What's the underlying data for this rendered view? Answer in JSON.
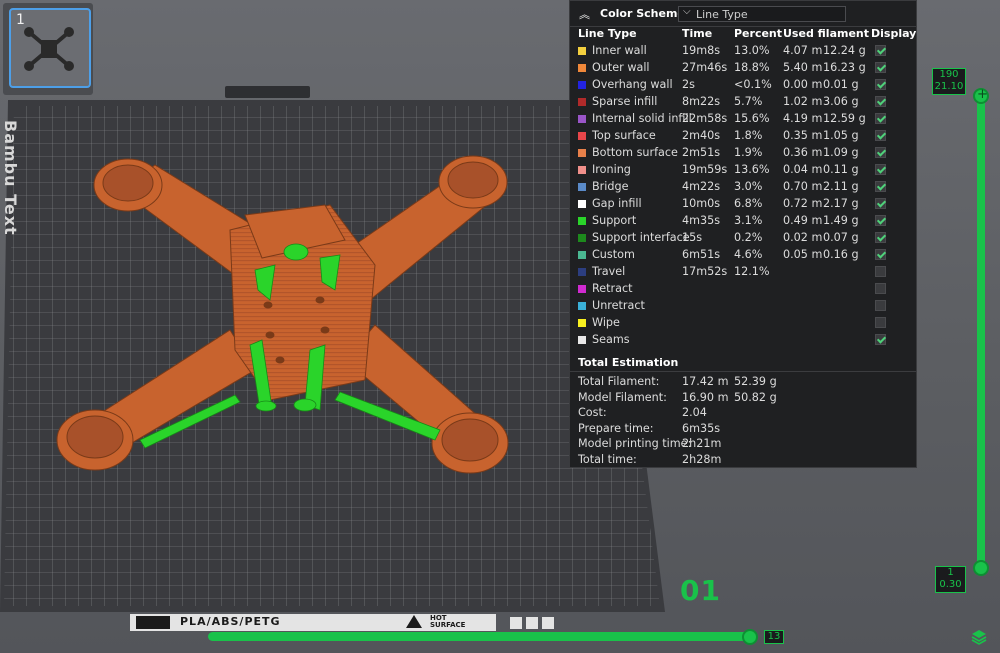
{
  "thumbnail": {
    "plate_index": "1"
  },
  "color_scheme": {
    "title": "Color Scheme",
    "selected": "Line Type"
  },
  "columns": {
    "line_type": "Line Type",
    "time": "Time",
    "percent": "Percent",
    "used_filament": "Used filament",
    "display": "Display"
  },
  "line_types": [
    {
      "name": "Inner wall",
      "color": "#f4d03f",
      "time": "19m8s",
      "percent": "13.0%",
      "length": "4.07 m",
      "weight": "12.24 g",
      "display": true
    },
    {
      "name": "Outer wall",
      "color": "#f0883a",
      "time": "27m46s",
      "percent": "18.8%",
      "length": "5.40 m",
      "weight": "16.23 g",
      "display": true
    },
    {
      "name": "Overhang wall",
      "color": "#2323e0",
      "time": "2s",
      "percent": "<0.1%",
      "length": "0.00 m",
      "weight": "0.01 g",
      "display": true
    },
    {
      "name": "Sparse infill",
      "color": "#b02a2a",
      "time": "8m22s",
      "percent": "5.7%",
      "length": "1.02 m",
      "weight": "3.06 g",
      "display": true
    },
    {
      "name": "Internal solid infill",
      "color": "#9a55c8",
      "time": "22m58s",
      "percent": "15.6%",
      "length": "4.19 m",
      "weight": "12.59 g",
      "display": true
    },
    {
      "name": "Top surface",
      "color": "#e8464a",
      "time": "2m40s",
      "percent": "1.8%",
      "length": "0.35 m",
      "weight": "1.05 g",
      "display": true
    },
    {
      "name": "Bottom surface",
      "color": "#e8804a",
      "time": "2m51s",
      "percent": "1.9%",
      "length": "0.36 m",
      "weight": "1.09 g",
      "display": true
    },
    {
      "name": "Ironing",
      "color": "#f08f8a",
      "time": "19m59s",
      "percent": "13.6%",
      "length": "0.04 m",
      "weight": "0.11 g",
      "display": true
    },
    {
      "name": "Bridge",
      "color": "#5a8ac8",
      "time": "4m22s",
      "percent": "3.0%",
      "length": "0.70 m",
      "weight": "2.11 g",
      "display": true
    },
    {
      "name": "Gap infill",
      "color": "#ffffff",
      "time": "10m0s",
      "percent": "6.8%",
      "length": "0.72 m",
      "weight": "2.17 g",
      "display": true
    },
    {
      "name": "Support",
      "color": "#2ad42a",
      "time": "4m35s",
      "percent": "3.1%",
      "length": "0.49 m",
      "weight": "1.49 g",
      "display": true
    },
    {
      "name": "Support interface",
      "color": "#1d8a1d",
      "time": "15s",
      "percent": "0.2%",
      "length": "0.02 m",
      "weight": "0.07 g",
      "display": true
    },
    {
      "name": "Custom",
      "color": "#4ab892",
      "time": "6m51s",
      "percent": "4.6%",
      "length": "0.05 m",
      "weight": "0.16 g",
      "display": true
    },
    {
      "name": "Travel",
      "color": "#2c3e80",
      "time": "17m52s",
      "percent": "12.1%",
      "length": "",
      "weight": "",
      "display": false
    },
    {
      "name": "Retract",
      "color": "#d02ad0",
      "time": "",
      "percent": "",
      "length": "",
      "weight": "",
      "display": false
    },
    {
      "name": "Unretract",
      "color": "#3ab0d8",
      "time": "",
      "percent": "",
      "length": "",
      "weight": "",
      "display": false
    },
    {
      "name": "Wipe",
      "color": "#f8f020",
      "time": "",
      "percent": "",
      "length": "",
      "weight": "",
      "display": false
    },
    {
      "name": "Seams",
      "color": "#e8e8e8",
      "time": "",
      "percent": "",
      "length": "",
      "weight": "",
      "display": true
    }
  ],
  "total_estimation": {
    "title": "Total Estimation",
    "rows": [
      {
        "key": "Total Filament:",
        "v1": "17.42 m",
        "v2": "52.39 g"
      },
      {
        "key": "Model Filament:",
        "v1": "16.90 m",
        "v2": "50.82 g"
      },
      {
        "key": "Cost:",
        "v1": "2.04",
        "v2": ""
      },
      {
        "key": "Prepare time:",
        "v1": "6m35s",
        "v2": ""
      },
      {
        "key": "Model printing time:",
        "v1": "2h21m",
        "v2": ""
      },
      {
        "key": "Total time:",
        "v1": "2h28m",
        "v2": ""
      }
    ]
  },
  "layer_slider": {
    "top_layer": "190",
    "top_height": "21.10",
    "bottom_layer": "1",
    "bottom_height": "0.30"
  },
  "move_slider": {
    "value": "13"
  },
  "plate_number": "01",
  "bed": {
    "brand_text": "Bambu Text",
    "materials": "PLA/ABS/PETG",
    "hot_surface_line1": "HOT",
    "hot_surface_line2": "SURFACE"
  },
  "colors": {
    "accent": "#19c24a",
    "model": "#c8632e",
    "support": "#2ad42a",
    "thumbnail_border": "#4d9fe8"
  }
}
